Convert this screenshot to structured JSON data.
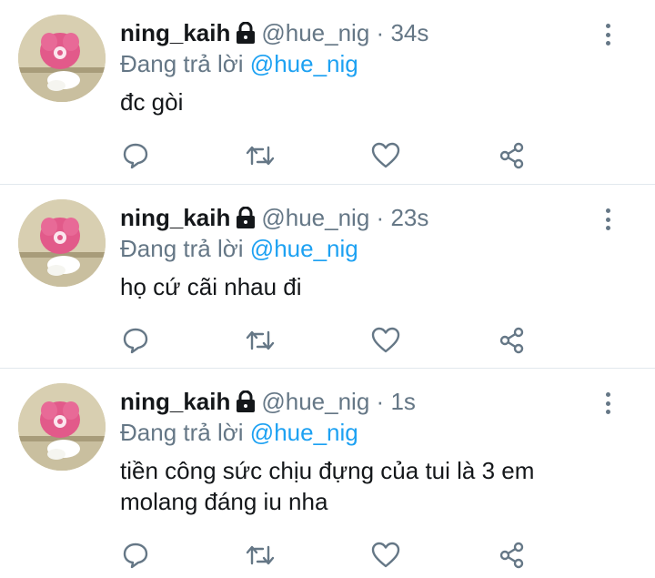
{
  "tweets": [
    {
      "display_name": "ning_kaih",
      "handle": "@hue_nig",
      "separator": "·",
      "time": "34s",
      "reply_prefix": "Đang trả lời",
      "reply_mention": "@hue_nig",
      "text": "đc gòi"
    },
    {
      "display_name": "ning_kaih",
      "handle": "@hue_nig",
      "separator": "·",
      "time": "23s",
      "reply_prefix": "Đang trả lời",
      "reply_mention": "@hue_nig",
      "text": "họ cứ cãi nhau đi"
    },
    {
      "display_name": "ning_kaih",
      "handle": "@hue_nig",
      "separator": "·",
      "time": "1s",
      "reply_prefix": "Đang trả lời",
      "reply_mention": "@hue_nig",
      "text": "tiền công sức chịu đựng của tui là 3 em molang đáng iu nha"
    }
  ],
  "icons": {
    "lock": "lock-icon",
    "more": "more-vertical-icon",
    "reply": "reply-icon",
    "retweet": "retweet-icon",
    "like": "heart-icon",
    "share": "share-icon"
  },
  "colors": {
    "text": "#14171a",
    "secondary": "#657786",
    "mention": "#1da1f2",
    "divider": "#e1e8ed"
  }
}
